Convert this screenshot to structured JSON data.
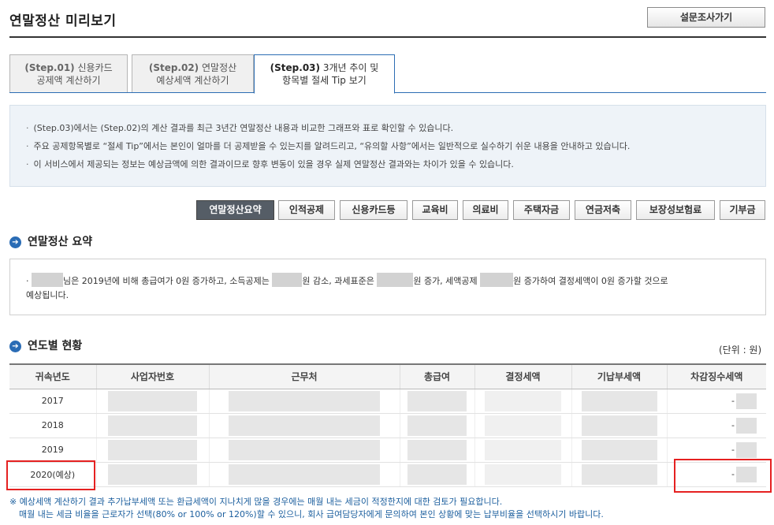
{
  "page": {
    "title": "연말정산 미리보기",
    "survey_button": "설문조사가기"
  },
  "tabs": [
    {
      "step": "(Step.01)",
      "line1": "신용카드",
      "line2": "공제액 계산하기"
    },
    {
      "step": "(Step.02)",
      "line1": "연말정산",
      "line2": "예상세액 계산하기"
    },
    {
      "step": "(Step.03)",
      "line1": "3개년 추이 및",
      "line2": "항목별 절세 Tip 보기"
    }
  ],
  "info": [
    "(Step.03)에서는 (Step.02)의 계산 결과를 최근 3년간 연말정산 내용과 비교한 그래프와 표로 확인할 수 있습니다.",
    "주요 공제항목별로 “절세 Tip”에서는 본인이 얼마를 더 공제받을 수 있는지를 알려드리고, “유의할 사항”에서는 일반적으로 실수하기 쉬운 내용을 안내하고 있습니다.",
    "이 서비스에서 제공되는 정보는 예상금액에 의한 결과이므로 향후 변동이 있을 경우 실제 연말정산 결과와는 차이가 있을 수 있습니다."
  ],
  "categories": [
    "연말정산요약",
    "인적공제",
    "신용카드등",
    "교육비",
    "의료비",
    "주택자금",
    "연금저축",
    "보장성보험료",
    "기부금"
  ],
  "summary": {
    "title": "연말정산 요약",
    "t1": "님은 2019년에 비해 총급여가 0원 증가하고, 소득공제는 ",
    "t2": "원 감소, 과세표준은 ",
    "t3": "원 증가, 세액공제 ",
    "t4": "원 증가하여 결정세액이 0원 증가할 것으로",
    "t5": "예상됩니다."
  },
  "yearly": {
    "title": "연도별 현황",
    "unit": "(단위 : 원)",
    "headers": [
      "귀속년도",
      "사업자번호",
      "근무처",
      "총급여",
      "결정세액",
      "기납부세액",
      "차감징수세액"
    ],
    "rows": [
      {
        "year": "2017",
        "diff": "-"
      },
      {
        "year": "2018",
        "diff": "-"
      },
      {
        "year": "2019",
        "diff": "-"
      },
      {
        "year": "2020(예상)",
        "diff": "-"
      }
    ]
  },
  "notes": {
    "line1": "※ 예상세액 계산하기 결과 추가납부세액 또는 환급세액이 지나치게 많을 경우에는 매월 내는 세금이 적정한지에 대한 검토가 필요합니다.",
    "line2": "매월 내는 세금 비율을 근로자가 선택(80% or 100% or 120%)할 수 있으니, 회사 급여담당자에게 문의하여 본인 상황에 맞는 납부비율을 선택하시기 바랍니다."
  },
  "colors": {
    "accent": "#2a6cb5",
    "highlight": "#e52121",
    "note": "#1c5f9e"
  }
}
